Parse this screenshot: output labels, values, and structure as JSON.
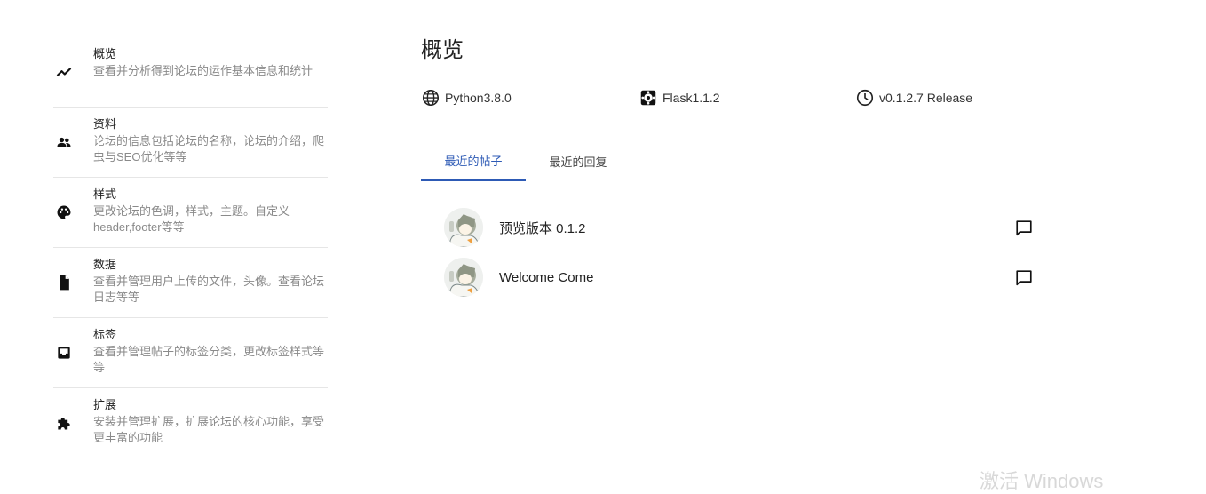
{
  "sidebar": {
    "items": [
      {
        "title": "概览",
        "desc": "查看并分析得到论坛的运作基本信息和统计",
        "icon": "trending-up-icon"
      },
      {
        "title": "资料",
        "desc": "论坛的信息包括论坛的名称，论坛的介绍，爬虫与SEO优化等等",
        "icon": "people-icon"
      },
      {
        "title": "样式",
        "desc": "更改论坛的色调，样式，主题。自定义header,footer等等",
        "icon": "palette-icon"
      },
      {
        "title": "数据",
        "desc": "查看并管理用户上传的文件，头像。查看论坛日志等等",
        "icon": "file-icon"
      },
      {
        "title": "标签",
        "desc": "查看并管理帖子的标签分类，更改标签样式等等",
        "icon": "inbox-icon"
      },
      {
        "title": "扩展",
        "desc": "安装并管理扩展，扩展论坛的核心功能，享受更丰富的功能",
        "icon": "extension-icon"
      }
    ]
  },
  "main": {
    "title": "概览",
    "versions": [
      {
        "label": "Python3.8.0",
        "icon": "globe-icon"
      },
      {
        "label": "Flask1.1.2",
        "icon": "flask-icon"
      },
      {
        "label": "v0.1.2.7 Release",
        "icon": "clock-icon"
      }
    ],
    "tabs": [
      {
        "label": "最近的帖子",
        "active": true
      },
      {
        "label": "最近的回复",
        "active": false
      }
    ],
    "posts": [
      {
        "title": "预览版本 0.1.2",
        "avatar": "user-avatar",
        "action_icon": "comment-icon"
      },
      {
        "title": "Welcome Come",
        "avatar": "user-avatar",
        "action_icon": "comment-icon"
      }
    ]
  },
  "watermark": "激活 Windows",
  "colors": {
    "accent": "#2d5ab5",
    "text": "#222222",
    "muted": "#8a8a8a",
    "divider": "#e6e6e6"
  }
}
